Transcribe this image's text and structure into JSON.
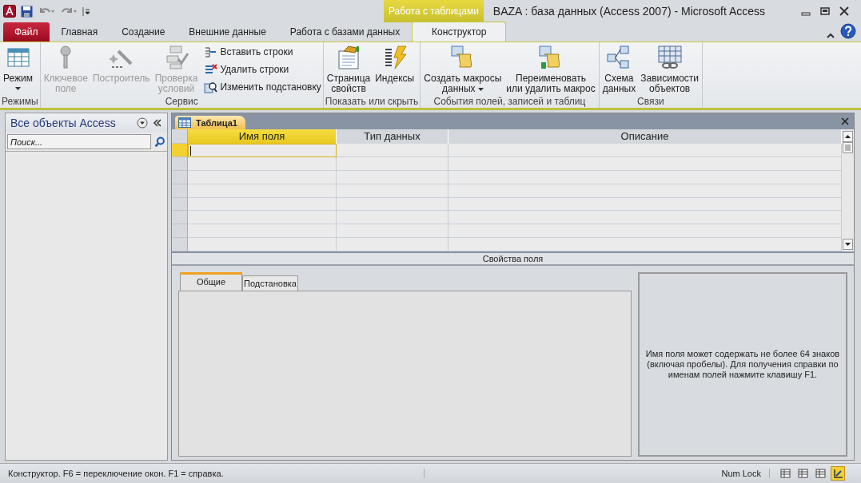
{
  "window": {
    "title": "BAZA : база данных (Access 2007)  -  Microsoft Access",
    "context_group": "Работа с таблицами"
  },
  "ribbon_tabs": [
    {
      "label": "Файл",
      "kind": "file",
      "selected": false
    },
    {
      "label": "Главная",
      "kind": "tab",
      "selected": false
    },
    {
      "label": "Создание",
      "kind": "tab",
      "selected": false
    },
    {
      "label": "Внешние данные",
      "kind": "tab",
      "selected": false
    },
    {
      "label": "Работа с базами данных",
      "kind": "tab",
      "selected": false
    },
    {
      "label": "Конструктор",
      "kind": "tab",
      "selected": true
    }
  ],
  "ribbon_groups": [
    {
      "label": "Режимы",
      "buttons": [
        {
          "kind": "large",
          "lines": [
            "Режим"
          ],
          "dropdown": true,
          "disabled": false
        }
      ]
    },
    {
      "label": "Сервис",
      "buttons": [
        {
          "kind": "large",
          "lines": [
            "Ключевое",
            "поле"
          ],
          "disabled": true
        },
        {
          "kind": "large",
          "lines": [
            "Построитель"
          ],
          "disabled": true
        },
        {
          "kind": "large",
          "lines": [
            "Проверка",
            "условий"
          ],
          "disabled": true
        },
        {
          "kind": "small",
          "lines": [
            "Вставить строки"
          ],
          "disabled": false
        },
        {
          "kind": "small",
          "lines": [
            "Удалить строки"
          ],
          "disabled": false
        },
        {
          "kind": "small",
          "lines": [
            "Изменить подстановку"
          ],
          "disabled": false
        }
      ]
    },
    {
      "label": "Показать или скрыть",
      "buttons": [
        {
          "kind": "large",
          "lines": [
            "Страница",
            "свойств"
          ],
          "disabled": false
        },
        {
          "kind": "large",
          "lines": [
            "Индексы"
          ],
          "disabled": false
        }
      ]
    },
    {
      "label": "События полей, записей и таблиц",
      "buttons": [
        {
          "kind": "large",
          "lines": [
            "Создать макросы",
            "данных"
          ],
          "dropdown": true,
          "disabled": false
        },
        {
          "kind": "large",
          "lines": [
            "Переименовать",
            "или удалить макрос"
          ],
          "disabled": false
        }
      ]
    },
    {
      "label": "Связи",
      "buttons": [
        {
          "kind": "large",
          "lines": [
            "Схема",
            "данных"
          ],
          "disabled": false
        },
        {
          "kind": "large",
          "lines": [
            "Зависимости",
            "объектов"
          ],
          "disabled": false
        }
      ]
    }
  ],
  "nav_pane": {
    "title": "Все объекты Access",
    "search": {
      "placeholder": "Поиск..."
    }
  },
  "document_tab": {
    "label": "Таблица1"
  },
  "design_grid": {
    "columns": [
      {
        "label": "Имя поля",
        "selected": true
      },
      {
        "label": "Тип данных",
        "selected": false
      },
      {
        "label": "Описание",
        "selected": false
      }
    ],
    "rows": [
      {
        "selected": true
      },
      {
        "selected": false
      },
      {
        "selected": false
      },
      {
        "selected": false
      },
      {
        "selected": false
      },
      {
        "selected": false
      },
      {
        "selected": false
      },
      {
        "selected": false
      }
    ]
  },
  "field_properties": {
    "title": "Свойства поля",
    "tabs": [
      {
        "label": "Общие",
        "selected": true
      },
      {
        "label": "Подстановка",
        "selected": false
      }
    ],
    "help_text": "Имя поля может содержать не более 64 знаков (включая пробелы). Для получения справки по именам полей нажмите клавишу F1."
  },
  "status_bar": {
    "text": "Конструктор.  F6 = переключение окон.  F1 = справка.",
    "num_lock": "Num Lock",
    "views": [
      {
        "selected": false
      },
      {
        "selected": false
      },
      {
        "selected": false
      },
      {
        "selected": true
      }
    ]
  }
}
